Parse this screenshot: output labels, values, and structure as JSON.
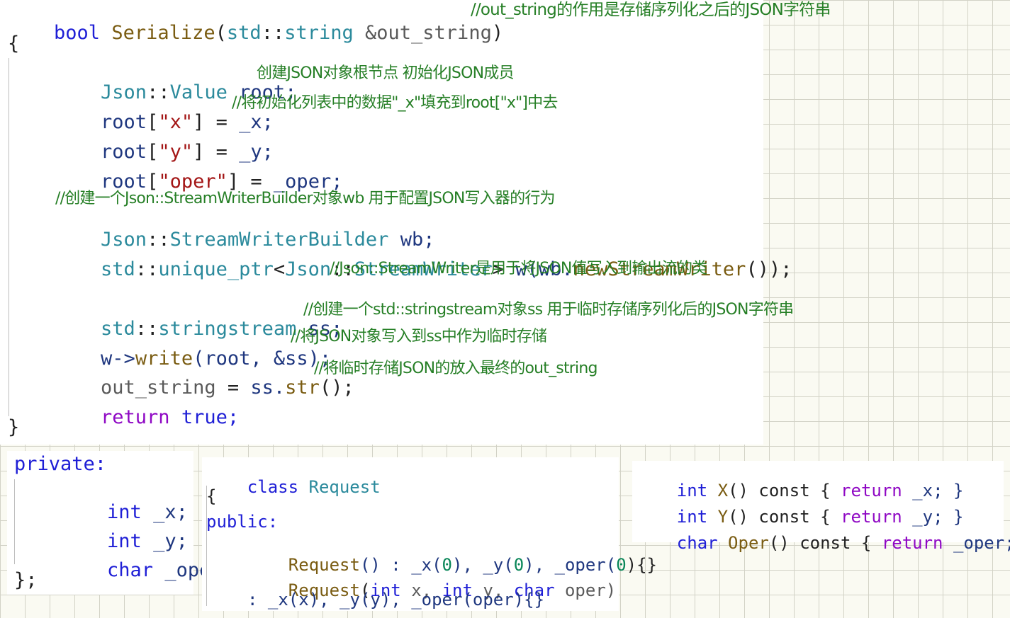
{
  "main_panel": {
    "signature": {
      "ret": "bool",
      "func": "Serialize",
      "open": "(",
      "ns": "std",
      "sep": "::",
      "type": "string",
      "param": "&out_string",
      "close": ")",
      "comment": "//out_string的作用是存储序列化之后的JSON字符串"
    },
    "open_brace": "{",
    "line_root": {
      "ns": "Json",
      "sep": "::",
      "type": "Value",
      "var": "root;",
      "comment": "创建JSON对象根节点 初始化JSON成员"
    },
    "line_x": {
      "var": "root",
      "lb": "[",
      "key": "\"x\"",
      "rb": "]",
      "eq": " = ",
      "val": "_x;",
      "comment": "//将初始化列表中的数据\"_x\"填充到root[\"x\"]中去"
    },
    "line_y": {
      "var": "root",
      "lb": "[",
      "key": "\"y\"",
      "rb": "]",
      "eq": " = ",
      "val": "_y;"
    },
    "line_oper": {
      "var": "root",
      "lb": "[",
      "key": "\"oper\"",
      "rb": "]",
      "eq": " = ",
      "val": "_oper;"
    },
    "comment_builder": "//创建一个Json::StreamWriterBuilder对象wb 用于配置JSON写入器的行为",
    "line_builder": {
      "ns": "Json",
      "sep": "::",
      "type": "StreamWriterBuilder",
      "var": " wb;"
    },
    "line_writer": {
      "ns1": "std",
      "sep": "::",
      "t1": "unique_ptr",
      "lt": "<",
      "ns2": "Json",
      "t2": "StreamWriter",
      "gt": ">",
      "var": " w(wb.",
      "fn": "newStreamWriter",
      "end": "());"
    },
    "comment_writer": "//Json::StreamWriter是用于将JSON值写入到输出流的类",
    "line_ss": {
      "ns": "std",
      "sep": "::",
      "type": "stringstream",
      "var": " ss;",
      "comment": "//创建一个std::stringstream对象ss 用于临时存储序列化后的JSON字符串"
    },
    "line_write": {
      "obj": "w->",
      "fn": "write",
      "args": "(root, &ss);",
      "comment": "//将JSON对象写入到ss中作为临时存储"
    },
    "line_out": {
      "var": "out_string",
      "eq": " = ",
      "obj": "ss.",
      "fn": "str",
      "end": "();",
      "comment": "//将临时存储JSON的放入最终的out_string"
    },
    "line_return": {
      "kw": "return",
      "val": " true;"
    },
    "close_brace": "}"
  },
  "private_panel": {
    "label": "private:",
    "members": [
      {
        "type": "int",
        "name": " _x;"
      },
      {
        "type": "int",
        "name": " _y;"
      },
      {
        "type": "char",
        "name": " _oper;"
      }
    ],
    "close": "};"
  },
  "class_panel": {
    "kw": "class",
    "name": " Request",
    "open": "{",
    "access": "public:",
    "ctor1": {
      "name": "Request",
      "rest": "() : _x(",
      "n1": "0",
      "m1": "), _y(",
      "n2": "0",
      "m2": "), _oper(",
      "n3": "0",
      "end": "){}"
    },
    "ctor2": {
      "name": "Request",
      "p1": "(",
      "t1": "int",
      "a1": " x, ",
      "t2": "int",
      "a2": " y, ",
      "t3": "char",
      "a3": " oper)"
    },
    "ctor3": ": _x(x), _y(y), _oper(oper){}"
  },
  "getter_panel": {
    "getters": [
      {
        "type": "int",
        "name": " X",
        "sig": "() const { ",
        "kw": "return",
        "body": " _x; }"
      },
      {
        "type": "int",
        "name": " Y",
        "sig": "() const { ",
        "kw": "return",
        "body": " _y; }"
      },
      {
        "type": "char",
        "name": " Oper",
        "sig": "() const { ",
        "kw": "return",
        "body": " _oper; }"
      }
    ]
  }
}
